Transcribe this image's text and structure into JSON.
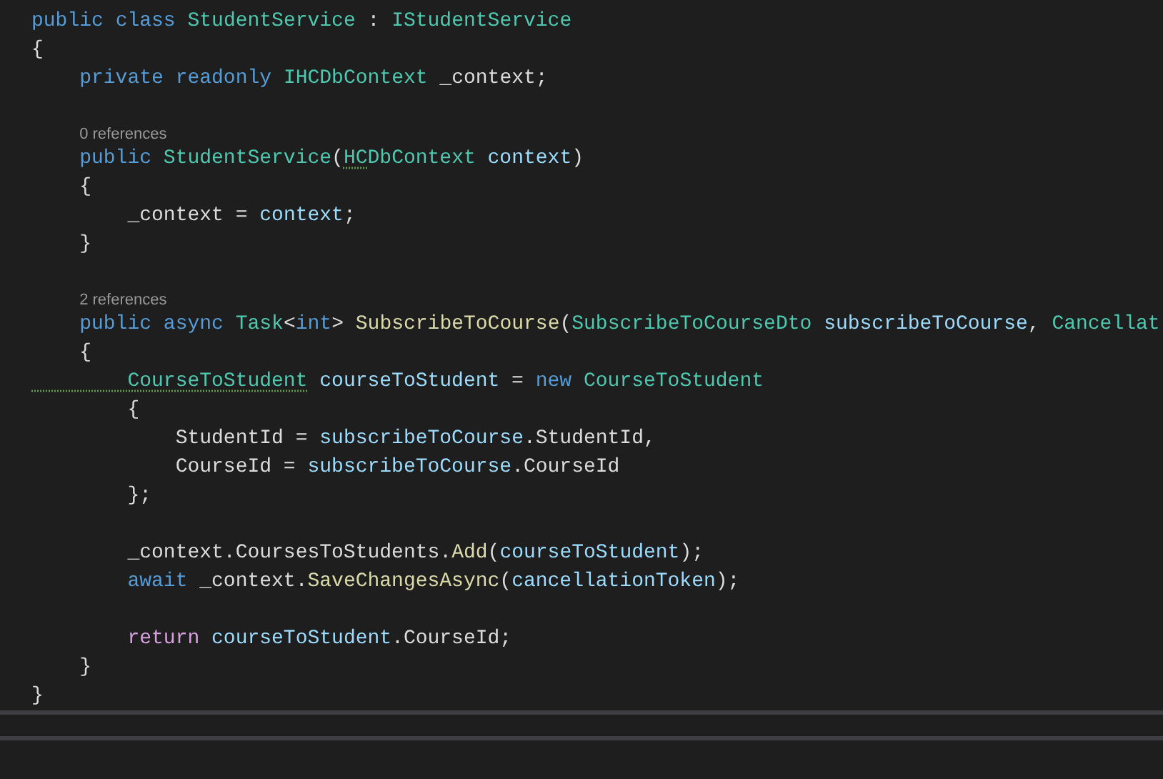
{
  "editor": {
    "lines": [
      {
        "kind": "code",
        "tokens": [
          {
            "kind": "kw",
            "t": "public "
          },
          {
            "kind": "kw",
            "t": "class "
          },
          {
            "kind": "type",
            "t": "StudentService"
          },
          {
            "kind": "text",
            "t": " : "
          },
          {
            "kind": "type",
            "t": "IStudentService"
          }
        ]
      },
      {
        "kind": "code",
        "tokens": [
          {
            "kind": "text",
            "t": "{"
          }
        ]
      },
      {
        "kind": "code",
        "tokens": [
          {
            "kind": "kw",
            "t": "    private "
          },
          {
            "kind": "kw",
            "t": "readonly "
          },
          {
            "kind": "type",
            "t": "IHCDbContext"
          },
          {
            "kind": "text",
            "t": " _context;"
          }
        ]
      },
      {
        "kind": "blank"
      },
      {
        "kind": "lens",
        "text": "0 references"
      },
      {
        "kind": "code",
        "tokens": [
          {
            "kind": "kw",
            "t": "    public "
          },
          {
            "kind": "type",
            "t": "StudentService"
          },
          {
            "kind": "text",
            "t": "("
          },
          {
            "kind": "warn",
            "t": "HC"
          },
          {
            "kind": "type",
            "t": "DbContext "
          },
          {
            "kind": "param",
            "t": "context"
          },
          {
            "kind": "text",
            "t": ")"
          }
        ]
      },
      {
        "kind": "code",
        "tokens": [
          {
            "kind": "text",
            "t": "    {"
          }
        ]
      },
      {
        "kind": "code",
        "tokens": [
          {
            "kind": "text",
            "t": "        _context = "
          },
          {
            "kind": "param",
            "t": "context"
          },
          {
            "kind": "text",
            "t": ";"
          }
        ]
      },
      {
        "kind": "code",
        "tokens": [
          {
            "kind": "text",
            "t": "    }"
          }
        ]
      },
      {
        "kind": "blank"
      },
      {
        "kind": "lens",
        "text": "2 references"
      },
      {
        "kind": "code",
        "tokens": [
          {
            "kind": "kw",
            "t": "    public "
          },
          {
            "kind": "kw",
            "t": "async "
          },
          {
            "kind": "type",
            "t": "Task"
          },
          {
            "kind": "text",
            "t": "<"
          },
          {
            "kind": "kw",
            "t": "int"
          },
          {
            "kind": "text",
            "t": "> "
          },
          {
            "kind": "method",
            "t": "SubscribeToCourse"
          },
          {
            "kind": "text",
            "t": "("
          },
          {
            "kind": "type",
            "t": "SubscribeToCourseDto "
          },
          {
            "kind": "param",
            "t": "subscribeToCourse"
          },
          {
            "kind": "text",
            "t": ", "
          },
          {
            "kind": "type",
            "t": "Cancellat"
          }
        ]
      },
      {
        "kind": "code",
        "tokens": [
          {
            "kind": "text",
            "t": "    {"
          }
        ]
      },
      {
        "kind": "code",
        "tokens": [
          {
            "kind": "warn",
            "t": "        CourseToStudent"
          },
          {
            "kind": "param",
            "t": " courseToStudent"
          },
          {
            "kind": "text",
            "t": " = "
          },
          {
            "kind": "kw",
            "t": "new "
          },
          {
            "kind": "type",
            "t": "CourseToStudent"
          }
        ]
      },
      {
        "kind": "code",
        "tokens": [
          {
            "kind": "text",
            "t": "        {"
          }
        ]
      },
      {
        "kind": "code",
        "tokens": [
          {
            "kind": "text",
            "t": "            StudentId = "
          },
          {
            "kind": "param",
            "t": "subscribeToCourse"
          },
          {
            "kind": "text",
            "t": ".StudentId,"
          }
        ]
      },
      {
        "kind": "code",
        "tokens": [
          {
            "kind": "text",
            "t": "            CourseId = "
          },
          {
            "kind": "param",
            "t": "subscribeToCourse"
          },
          {
            "kind": "text",
            "t": ".CourseId"
          }
        ]
      },
      {
        "kind": "code",
        "tokens": [
          {
            "kind": "text",
            "t": "        };"
          }
        ]
      },
      {
        "kind": "blank"
      },
      {
        "kind": "code",
        "tokens": [
          {
            "kind": "text",
            "t": "        _context.CoursesToStudents."
          },
          {
            "kind": "method",
            "t": "Add"
          },
          {
            "kind": "text",
            "t": "("
          },
          {
            "kind": "param",
            "t": "courseToStudent"
          },
          {
            "kind": "text",
            "t": ");"
          }
        ]
      },
      {
        "kind": "code",
        "tokens": [
          {
            "kind": "kw",
            "t": "        await"
          },
          {
            "kind": "text",
            "t": " _context."
          },
          {
            "kind": "method",
            "t": "SaveChangesAsync"
          },
          {
            "kind": "text",
            "t": "("
          },
          {
            "kind": "param",
            "t": "cancellationToken"
          },
          {
            "kind": "text",
            "t": ");"
          }
        ]
      },
      {
        "kind": "blank"
      },
      {
        "kind": "code",
        "tokens": [
          {
            "kind": "ctl",
            "t": "        return"
          },
          {
            "kind": "param",
            "t": " courseToStudent"
          },
          {
            "kind": "text",
            "t": ".CourseId;"
          }
        ]
      },
      {
        "kind": "code",
        "tokens": [
          {
            "kind": "text",
            "t": "    }"
          }
        ]
      },
      {
        "kind": "code",
        "tokens": [
          {
            "kind": "text",
            "t": "}"
          }
        ]
      }
    ]
  }
}
